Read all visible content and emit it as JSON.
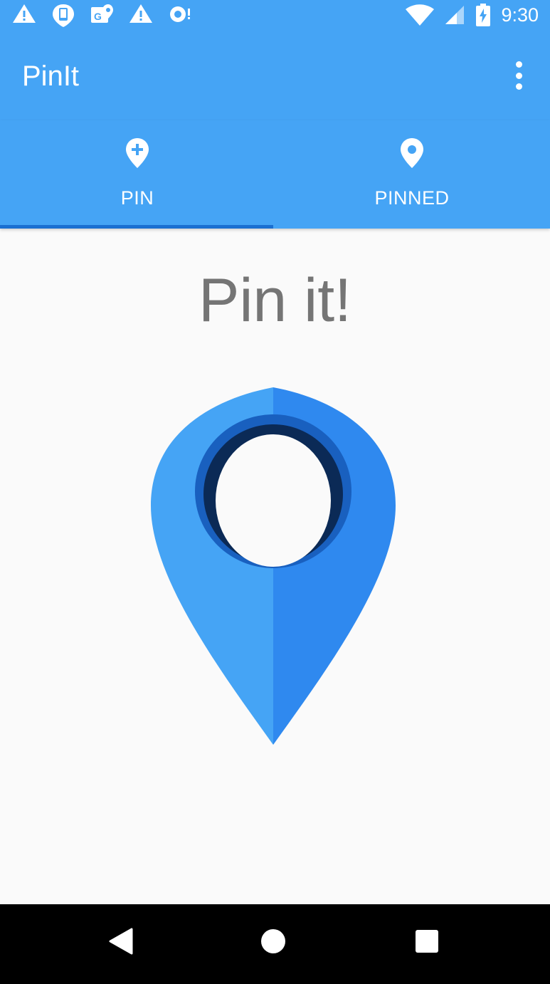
{
  "status_bar": {
    "time": "9:30",
    "left_icons": [
      "warning-icon",
      "phone-icon",
      "gallery-icon",
      "warning-icon",
      "sync-icon"
    ],
    "right_icons": [
      "wifi-icon",
      "cell-signal-icon",
      "battery-charging-icon"
    ]
  },
  "app_bar": {
    "title": "PinIt",
    "menu_icon": "more-vert-icon"
  },
  "tabs": [
    {
      "label": "PIN",
      "icon": "add-location-icon",
      "selected": true
    },
    {
      "label": "PINNED",
      "icon": "location-icon",
      "selected": false
    }
  ],
  "main": {
    "heading": "Pin it!",
    "image": "map-pin-icon"
  },
  "nav_bar": {
    "buttons": [
      "back-icon",
      "home-icon",
      "recents-icon"
    ]
  },
  "colors": {
    "primary": "#45a4f5",
    "indicator": "#1a6fd1",
    "pin_left": "#45a4f5",
    "pin_right": "#2f89ef",
    "pin_ring_outer": "#1960bf",
    "pin_ring_inner": "#0b2a56"
  }
}
